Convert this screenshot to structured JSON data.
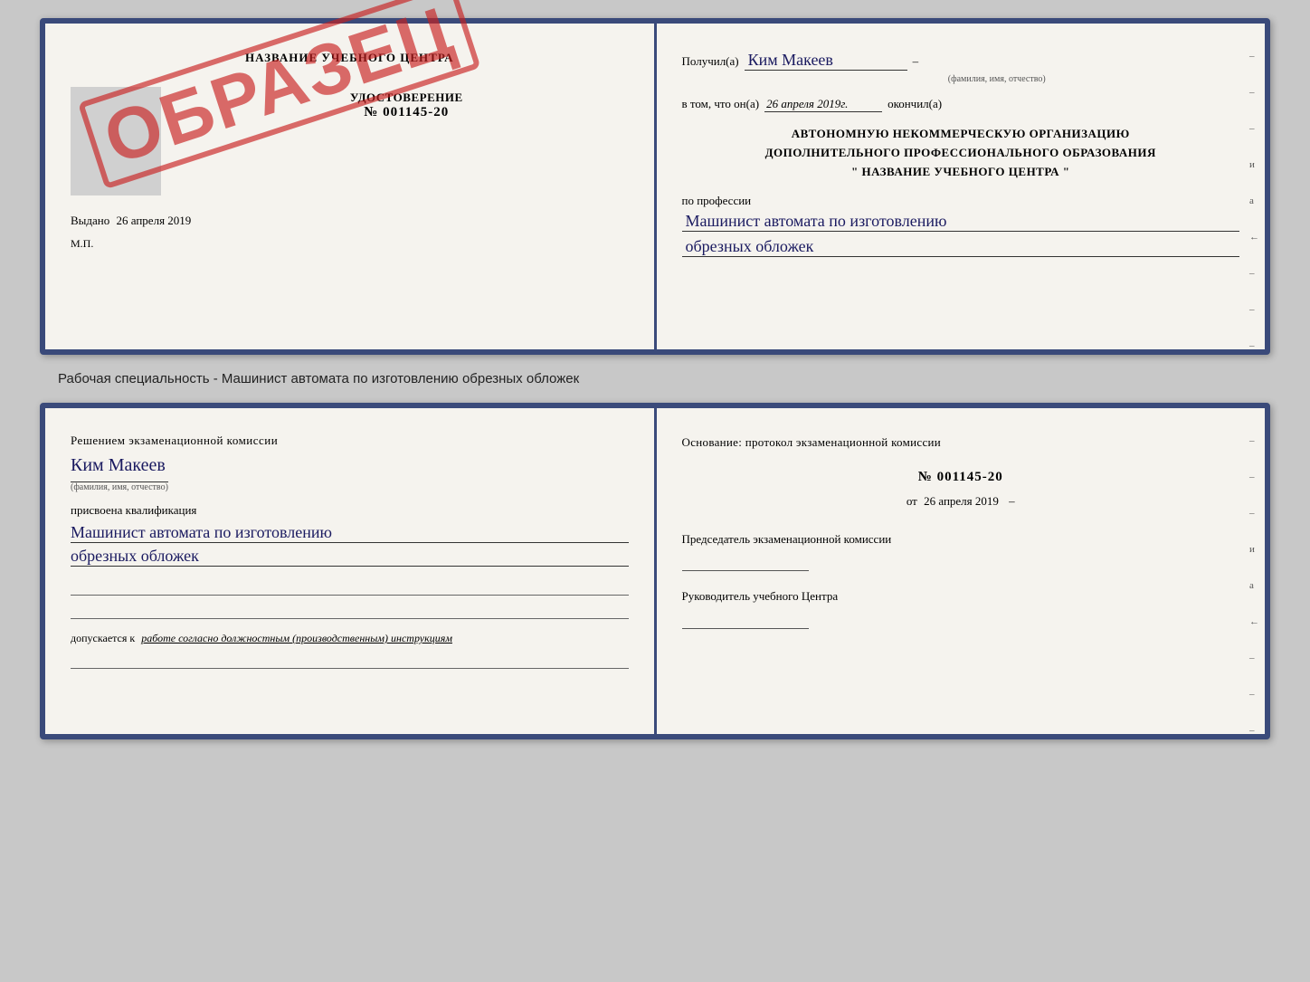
{
  "top_cert": {
    "left": {
      "title": "НАЗВАНИЕ УЧЕБНОГО ЦЕНТРА",
      "cert_label": "УДОСТОВЕРЕНИЕ",
      "cert_number": "№ 001145-20",
      "issued_label": "Выдано",
      "issued_date": "26 апреля 2019",
      "mp_label": "М.П.",
      "stamp_text": "ОБРАЗЕЦ"
    },
    "right": {
      "received_prefix": "Получил(а)",
      "recipient_name": "Ким Макеев",
      "name_subtitle": "(фамилия, имя, отчество)",
      "in_that_prefix": "в том, что он(а)",
      "completion_date": "26 апреля 2019г.",
      "finished_label": "окончил(а)",
      "org_line1": "АВТОНОМНУЮ НЕКОММЕРЧЕСКУЮ ОРГАНИЗАЦИЮ",
      "org_line2": "ДОПОЛНИТЕЛЬНОГО ПРОФЕССИОНАЛЬНОГО ОБРАЗОВАНИЯ",
      "org_line3": "\"  НАЗВАНИЕ УЧЕБНОГО ЦЕНТРА  \"",
      "profession_label": "по профессии",
      "profession_line1": "Машинист автомата по изготовлению",
      "profession_line2": "обрезных обложек",
      "edge_marks": [
        "-",
        "-",
        "-",
        "и",
        "а",
        "←",
        "-",
        "-",
        "-"
      ]
    }
  },
  "caption": "Рабочая специальность - Машинист автомата по изготовлению обрезных обложек",
  "bottom_cert": {
    "left": {
      "decision_text": "Решением экзаменационной комиссии",
      "name": "Ким Макеев",
      "name_subtitle": "(фамилия, имя, отчество)",
      "assigned_label": "присвоена квалификация",
      "qualification_line1": "Машинист автомата по изготовлению",
      "qualification_line2": "обрезных обложек",
      "allowed_prefix": "допускается к",
      "allowed_italic": "работе согласно должностным (производственным) инструкциям"
    },
    "right": {
      "basis_header": "Основание: протокол экзаменационной комиссии",
      "protocol_number": "№ 001145-20",
      "protocol_date_prefix": "от",
      "protocol_date": "26 апреля 2019",
      "chairman_label": "Председатель экзаменационной комиссии",
      "director_label": "Руководитель учебного Центра",
      "edge_marks": [
        "-",
        "-",
        "-",
        "и",
        "а",
        "←",
        "-",
        "-",
        "-"
      ]
    }
  }
}
